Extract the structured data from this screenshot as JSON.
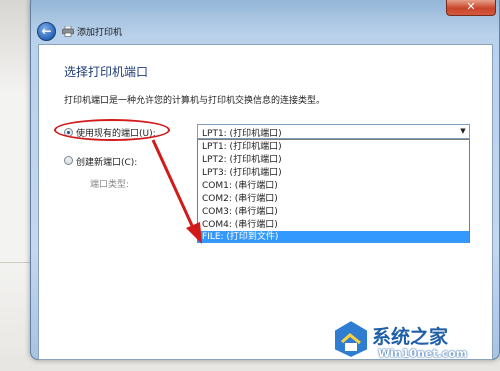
{
  "window": {
    "title": "添加打印机",
    "close_label": "✕"
  },
  "wizard": {
    "heading": "选择打印机端口",
    "description": "打印机端口是一种允许您的计算机与打印机交换信息的连接类型。"
  },
  "options": {
    "use_existing_label": "使用现有的端口(U):",
    "use_existing_selected": true,
    "create_new_label": "创建新端口(C):",
    "create_new_selected": false,
    "port_type_label": "端口类型:"
  },
  "combobox": {
    "value": "LPT1: (打印机端口)",
    "items": [
      "LPT1: (打印机端口)",
      "LPT2: (打印机端口)",
      "LPT3: (打印机端口)",
      "COM1: (串行端口)",
      "COM2: (串行端口)",
      "COM3: (串行端口)",
      "COM4: (串行端口)",
      "FILE: (打印到文件)"
    ],
    "highlighted_item": "FILE: (打印到文件)"
  },
  "watermark": {
    "name": "系统之家",
    "url": "Win10net.com"
  },
  "colors": {
    "highlight": "#3399ff",
    "annotation": "#d11a1a",
    "heading": "#1e3c78"
  }
}
